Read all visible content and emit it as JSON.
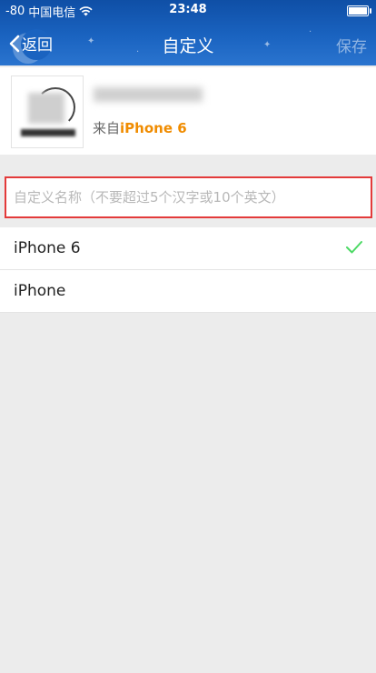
{
  "status_bar": {
    "signal": "-80",
    "carrier": "中国电信",
    "time": "23:48"
  },
  "nav": {
    "back_label": "返回",
    "title": "自定义",
    "save_label": "保存"
  },
  "device": {
    "from_prefix": "来自",
    "from_device": "iPhone 6"
  },
  "name_input": {
    "value": "",
    "placeholder": "自定义名称（不要超过5个汉字或10个英文）"
  },
  "options": [
    {
      "label": "iPhone 6",
      "selected": true
    },
    {
      "label": "iPhone",
      "selected": false
    }
  ],
  "colors": {
    "nav_blue": "#1a63c0",
    "accent_orange": "#f08c00",
    "check_green": "#4cd964",
    "input_border_red": "#e33a3a"
  }
}
